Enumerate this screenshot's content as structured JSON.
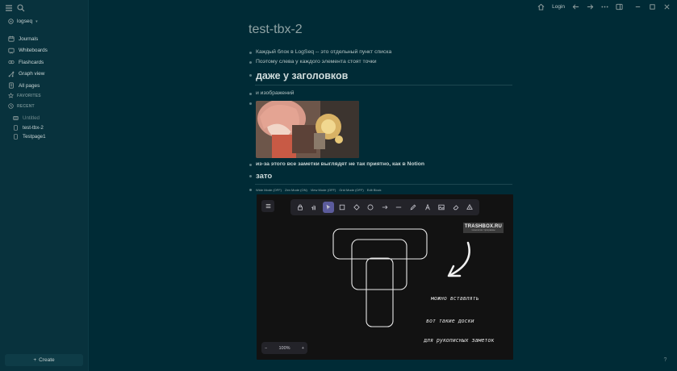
{
  "sidebar": {
    "graph_name": "logseq",
    "nav": [
      {
        "label": "Journals",
        "icon": "calendar-icon"
      },
      {
        "label": "Whiteboards",
        "icon": "whiteboard-icon"
      },
      {
        "label": "Flashcards",
        "icon": "flashcards-icon"
      },
      {
        "label": "Graph view",
        "icon": "graph-icon"
      },
      {
        "label": "All pages",
        "icon": "pages-icon"
      }
    ],
    "favorites_label": "FAVORITES",
    "recent_label": "RECENT",
    "recent": [
      {
        "label": "Untitled",
        "icon": "whiteboard-icon",
        "dim": true
      },
      {
        "label": "test-tbx-2",
        "icon": "page-icon"
      },
      {
        "label": "Testpage1",
        "icon": "page-icon"
      }
    ],
    "create_label": "Create"
  },
  "topbar": {
    "login_label": "Login"
  },
  "page": {
    "title": "test-tbx-2",
    "blocks": {
      "b1": "Каждый блок в LogSeq -- это отдельный пункт списка",
      "b2": "Поэтому слева у каждого элемента стоят точки",
      "b3": "даже у заголовков",
      "b4": "и изображений",
      "b5": "из-за этого все заметки выглядят не так приятно, как в Notion",
      "b6": "зато"
    },
    "whiteboard_options": {
      "wide": "Wide Mode (OFF)",
      "zen": "Zen Mode (ON)",
      "view": "View Mode (OFF)",
      "grid": "Grid Mode (OFF)",
      "edit": "Edit Block"
    }
  },
  "whiteboard": {
    "zoom": "100%",
    "watermark": "TRASHBOX.RU",
    "watermark_sub": "технологии / программы",
    "handwriting": [
      "можно вставлять",
      "вот такие доски",
      "для рукописных заметок"
    ]
  },
  "colors": {
    "background": "#002b36",
    "sidebar": "#08323d",
    "accent": "#5b5b9c"
  }
}
